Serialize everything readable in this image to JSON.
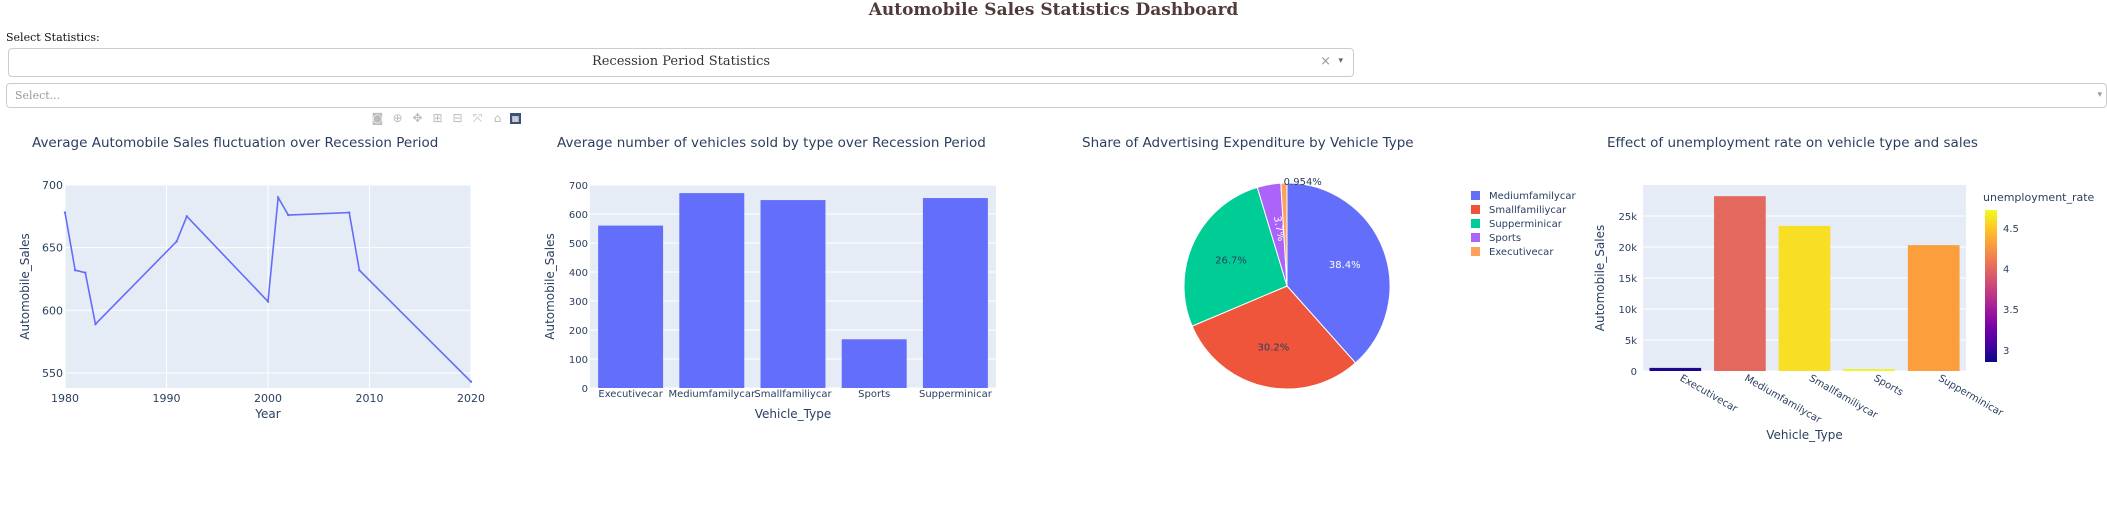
{
  "page": {
    "title": "Automobile Sales Statistics Dashboard",
    "select_label": "Select Statistics:",
    "stat_dropdown": {
      "value": "Recession Period Statistics",
      "clear": "×",
      "caret": "▾"
    },
    "year_dropdown": {
      "placeholder": "Select...",
      "caret": "▾"
    },
    "modebar": [
      "camera-icon",
      "zoom-icon",
      "pan-icon",
      "zoom-in-icon",
      "zoom-out-icon",
      "autoscale-icon",
      "reset-axes-icon",
      "plotly-logo-icon"
    ]
  },
  "colors": {
    "plot_bg": "#e5ecf6",
    "line": "#636efa",
    "grid": "#ffffff",
    "text": "#2a3f5f"
  },
  "chart_data": [
    {
      "type": "line",
      "title": "Average Automobile Sales fluctuation over Recession Period",
      "xlabel": "Year",
      "ylabel": "Automobile_Sales",
      "x": [
        1980,
        1981,
        1982,
        1983,
        1991,
        1992,
        2000,
        2001,
        2002,
        2008,
        2009,
        2020
      ],
      "y": [
        678,
        632,
        630,
        589,
        655,
        675,
        607,
        690,
        676,
        678,
        632,
        543
      ],
      "xlim": [
        1980,
        2020
      ],
      "ylim": [
        538,
        700
      ],
      "xticks": [
        1980,
        1990,
        2000,
        2010,
        2020
      ],
      "xtick_labels": [
        "1980",
        "1990",
        "2000",
        "2010",
        "2020"
      ],
      "yticks": [
        550,
        600,
        650,
        700
      ],
      "ytick_labels": [
        "550",
        "600",
        "650",
        "700"
      ],
      "grid": true,
      "color": "#636efa"
    },
    {
      "type": "bar",
      "title": "Average number of vehicles sold by type over Recession Period",
      "xlabel": "Vehicle_Type",
      "ylabel": "Automobile_Sales",
      "categories": [
        "Executivecar",
        "Mediumfamilycar",
        "Smallfamiliycar",
        "Sports",
        "Supperminicar"
      ],
      "values": [
        560,
        672,
        648,
        168,
        655
      ],
      "ylim": [
        0,
        700
      ],
      "yticks": [
        0,
        100,
        200,
        300,
        400,
        500,
        600,
        700
      ],
      "ytick_labels": [
        "0",
        "100",
        "200",
        "300",
        "400",
        "500",
        "600",
        "700"
      ],
      "grid": true,
      "color": "#636efa"
    },
    {
      "type": "pie",
      "title": "Share of Advertising Expenditure by Vehicle Type",
      "labels": [
        "Mediumfamilycar",
        "Smallfamiliycar",
        "Supperminicar",
        "Sports",
        "Executivecar"
      ],
      "values": [
        38.4,
        30.2,
        26.7,
        3.7,
        0.954
      ],
      "value_labels": [
        "38.4%",
        "30.2%",
        "26.7%",
        "3.7%",
        "0.954%"
      ],
      "colors": [
        "#636efa",
        "#ef553b",
        "#00cc96",
        "#ab63fa",
        "#ffa15a"
      ],
      "legend": "right"
    },
    {
      "type": "bar",
      "title": "Effect of unemployment rate on vehicle type and sales",
      "xlabel": "Vehicle_Type",
      "ylabel": "Automobile_Sales",
      "categories": [
        "Executivecar",
        "Mediumfamilycar",
        "Smallfamiliycar",
        "Sports",
        "Supperminicar"
      ],
      "values": [
        500,
        28200,
        23400,
        300,
        20300
      ],
      "unemployment_rate": [
        2.9,
        4.0,
        4.6,
        4.7,
        4.3
      ],
      "ylim": [
        0,
        30000
      ],
      "yticks": [
        0,
        5000,
        10000,
        15000,
        20000,
        25000
      ],
      "ytick_labels": [
        "0",
        "5k",
        "10k",
        "15k",
        "20k",
        "25k"
      ],
      "colorbar": {
        "title": "unemployment_rate",
        "range": [
          2.85,
          4.72
        ],
        "ticks": [
          3,
          3.5,
          4,
          4.5
        ],
        "tick_labels": [
          "3",
          "3.5",
          "4",
          "4.5"
        ],
        "scale": [
          "#0d0887",
          "#46039f",
          "#7201a8",
          "#9c179e",
          "#bd3786",
          "#d8576b",
          "#ed7953",
          "#fb9f3a",
          "#fdca26",
          "#f0f921"
        ]
      },
      "grid": true
    }
  ]
}
